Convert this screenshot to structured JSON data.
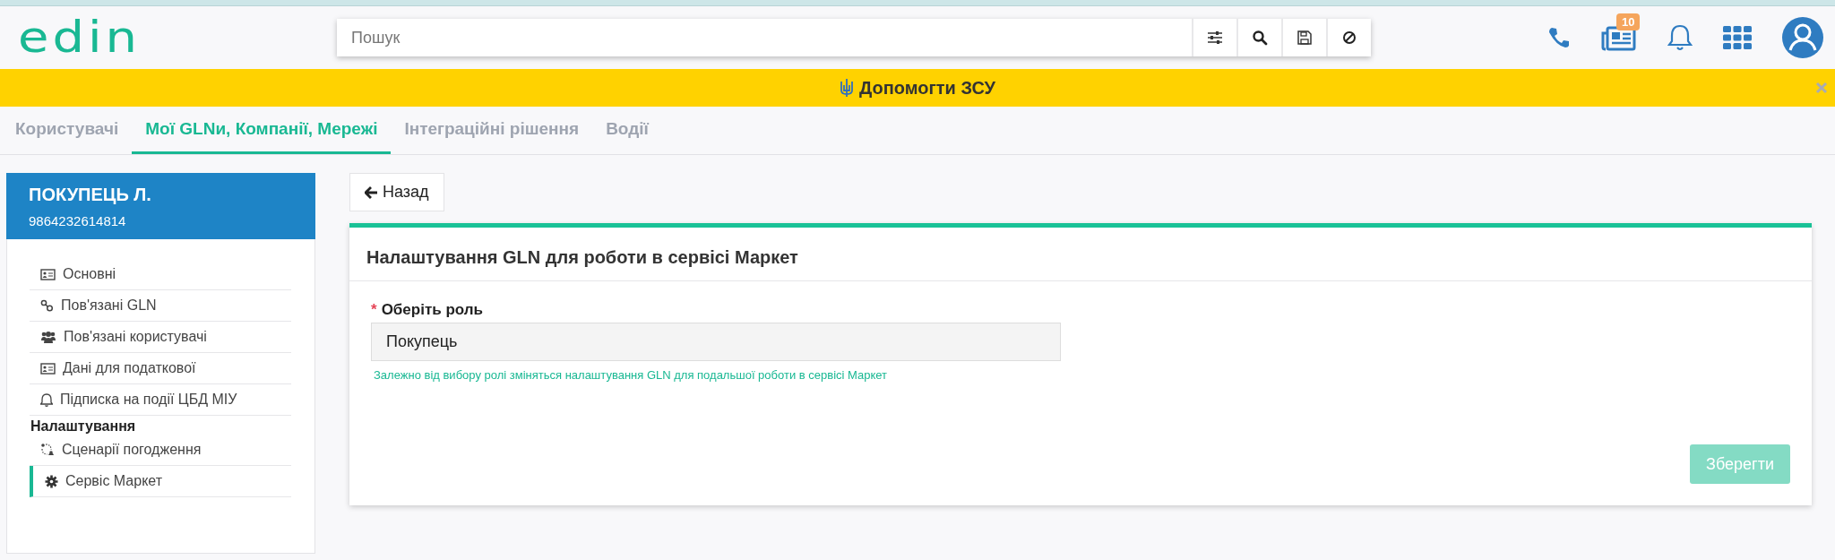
{
  "header": {
    "logo": "edin",
    "search": {
      "placeholder": "Пошук"
    },
    "news_badge": "10"
  },
  "banner": {
    "text": "Допомогти ЗСУ"
  },
  "tabs": [
    {
      "label": "Користувачі",
      "selected": false
    },
    {
      "label": "Мої GLNи, Компанії, Мережі",
      "selected": true
    },
    {
      "label": "Інтеграційні рішення",
      "selected": false
    },
    {
      "label": "Водії",
      "selected": false
    }
  ],
  "sidebar": {
    "company": "ПОКУПЕЦЬ Л.",
    "gln": "9864232614814",
    "items": [
      {
        "kind": "card",
        "label": "Основні",
        "selected": false
      },
      {
        "kind": "link",
        "label": "Пов'язані GLN",
        "selected": false
      },
      {
        "kind": "users",
        "label": "Пов'язані користувачі",
        "selected": false
      },
      {
        "kind": "card",
        "label": "Дані для податкової",
        "selected": false
      },
      {
        "kind": "bell",
        "label": "Підписка на події ЦБД МІУ",
        "selected": false
      },
      {
        "kind": "heading",
        "label": "Налаштування"
      },
      {
        "kind": "flow",
        "label": "Сценарії погодження",
        "selected": false
      },
      {
        "kind": "gear",
        "label": "Сервіс Маркет",
        "selected": true
      }
    ]
  },
  "back_button": "Назад",
  "card": {
    "title": "Налаштування GLN для роботи в сервісі Маркет",
    "field_label": "Оберіть роль",
    "required_mark": "*",
    "field_value": "Покупець",
    "hint": "Залежно від вибору ролі зміняться налаштування GLN для подальшої роботи в сервісі Маркет",
    "save_button": {
      "label": "Зберегти",
      "disabled": true
    }
  }
}
